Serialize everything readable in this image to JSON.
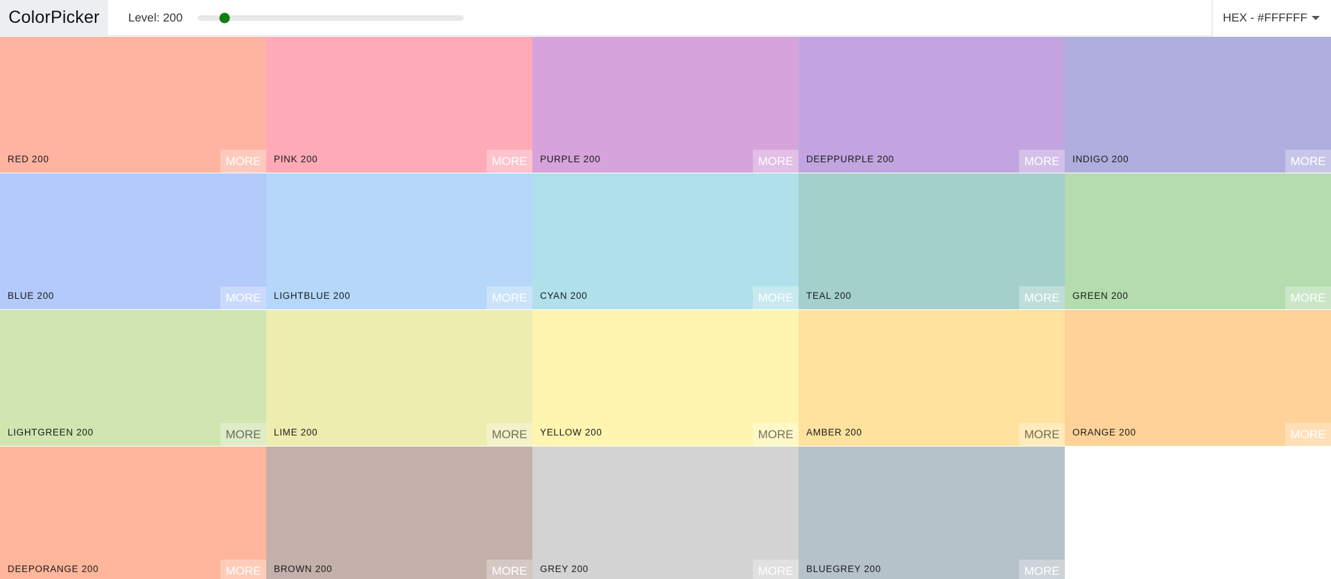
{
  "app": {
    "title": "ColorPicker"
  },
  "toolbar": {
    "level_label": "Level: 200",
    "slider_value_fraction": 0.1,
    "format_label": "HEX - #FFFFFF"
  },
  "colors": {
    "slider_handle": "#0f7f0f",
    "nav_logo_bg": "#eceff1"
  },
  "swatches": [
    {
      "name": "RED 200",
      "hex": "#FFB3A1",
      "more": "MORE",
      "dark": false
    },
    {
      "name": "PINK 200",
      "hex": "#FFAAB7",
      "more": "MORE",
      "dark": false
    },
    {
      "name": "PURPLE 200",
      "hex": "#D7A3DB",
      "more": "MORE",
      "dark": false
    },
    {
      "name": "DEEPPURPLE 200",
      "hex": "#C2A5E0",
      "more": "MORE",
      "dark": false
    },
    {
      "name": "INDIGO 200",
      "hex": "#B0AEDE",
      "more": "MORE",
      "dark": false
    },
    {
      "name": "BLUE 200",
      "hex": "#B4CAFB",
      "more": "MORE",
      "dark": false
    },
    {
      "name": "LIGHTBLUE 200",
      "hex": "#B4D7FA",
      "more": "MORE",
      "dark": false
    },
    {
      "name": "CYAN 200",
      "hex": "#B0E0EA",
      "more": "MORE",
      "dark": false
    },
    {
      "name": "TEAL 200",
      "hex": "#A3D0CB",
      "more": "MORE",
      "dark": false
    },
    {
      "name": "GREEN 200",
      "hex": "#B4DCAF",
      "more": "MORE",
      "dark": false
    },
    {
      "name": "LIGHTGREEN 200",
      "hex": "#D0E5B0",
      "more": "MORE",
      "dark": true
    },
    {
      "name": "LIME 200",
      "hex": "#EEEDB0",
      "more": "MORE",
      "dark": true
    },
    {
      "name": "YELLOW 200",
      "hex": "#FFF5B0",
      "more": "MORE",
      "dark": true
    },
    {
      "name": "AMBER 200",
      "hex": "#FFE29E",
      "more": "MORE",
      "dark": true
    },
    {
      "name": "ORANGE 200",
      "hex": "#FFD29A",
      "more": "MORE",
      "dark": false
    },
    {
      "name": "DEEPORANGE 200",
      "hex": "#FFB69B",
      "more": "MORE",
      "dark": false
    },
    {
      "name": "BROWN 200",
      "hex": "#C3B0AA",
      "more": "MORE",
      "dark": false
    },
    {
      "name": "GREY 200",
      "hex": "#D3D3D3",
      "more": "MORE",
      "dark": false
    },
    {
      "name": "BLUEGREY 200",
      "hex": "#B6C2CA",
      "more": "MORE",
      "dark": false
    }
  ]
}
